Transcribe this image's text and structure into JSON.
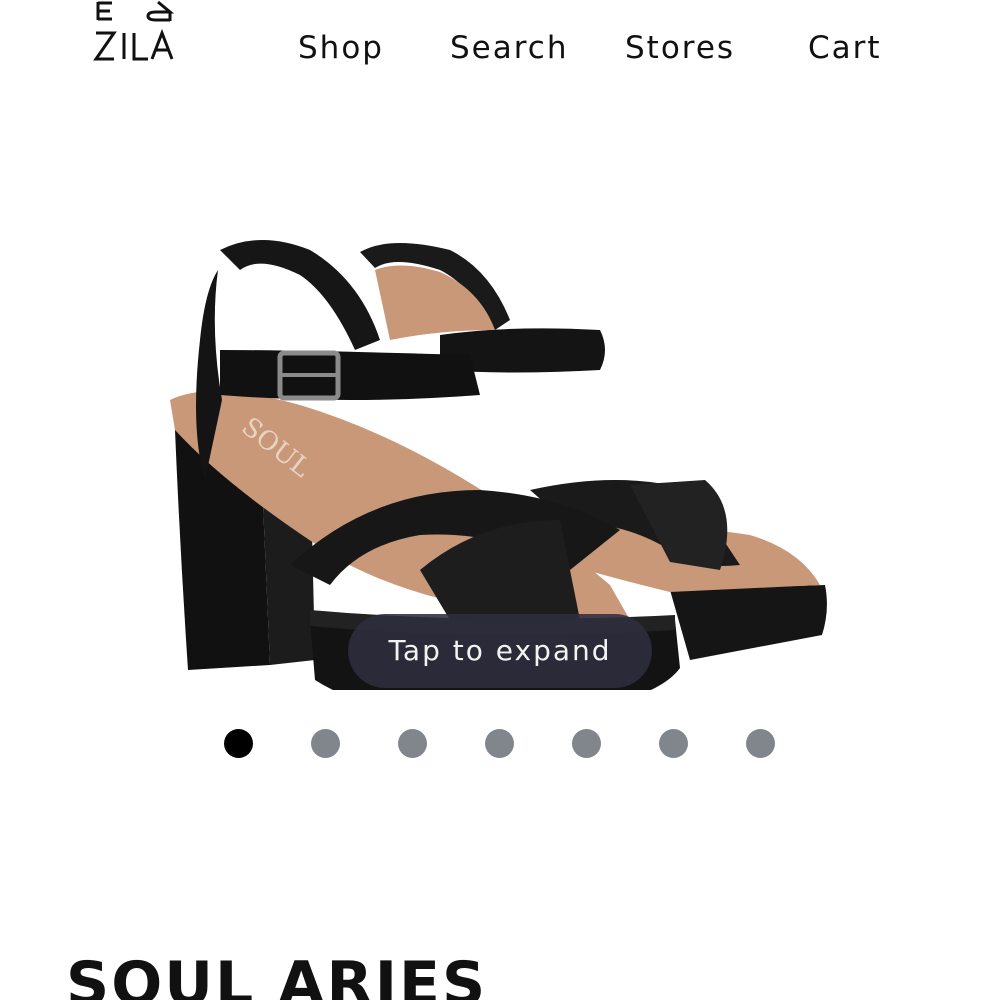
{
  "brand": {
    "logo_letters_top": "E R",
    "logo_letters_bottom": "ZILA"
  },
  "nav": {
    "shop": "Shop",
    "search": "Search",
    "stores": "Stores",
    "cart": "Cart"
  },
  "gallery": {
    "tap_label": "Tap to expand",
    "image_count": 7,
    "active_index": 0,
    "image_subject": "black leather platform block-heel sandal pair",
    "colors": {
      "dot_active": "#000000",
      "dot_inactive": "#80868b",
      "pill_bg": "#2e2e3e"
    }
  },
  "product": {
    "title": "SOUL ARIES"
  }
}
